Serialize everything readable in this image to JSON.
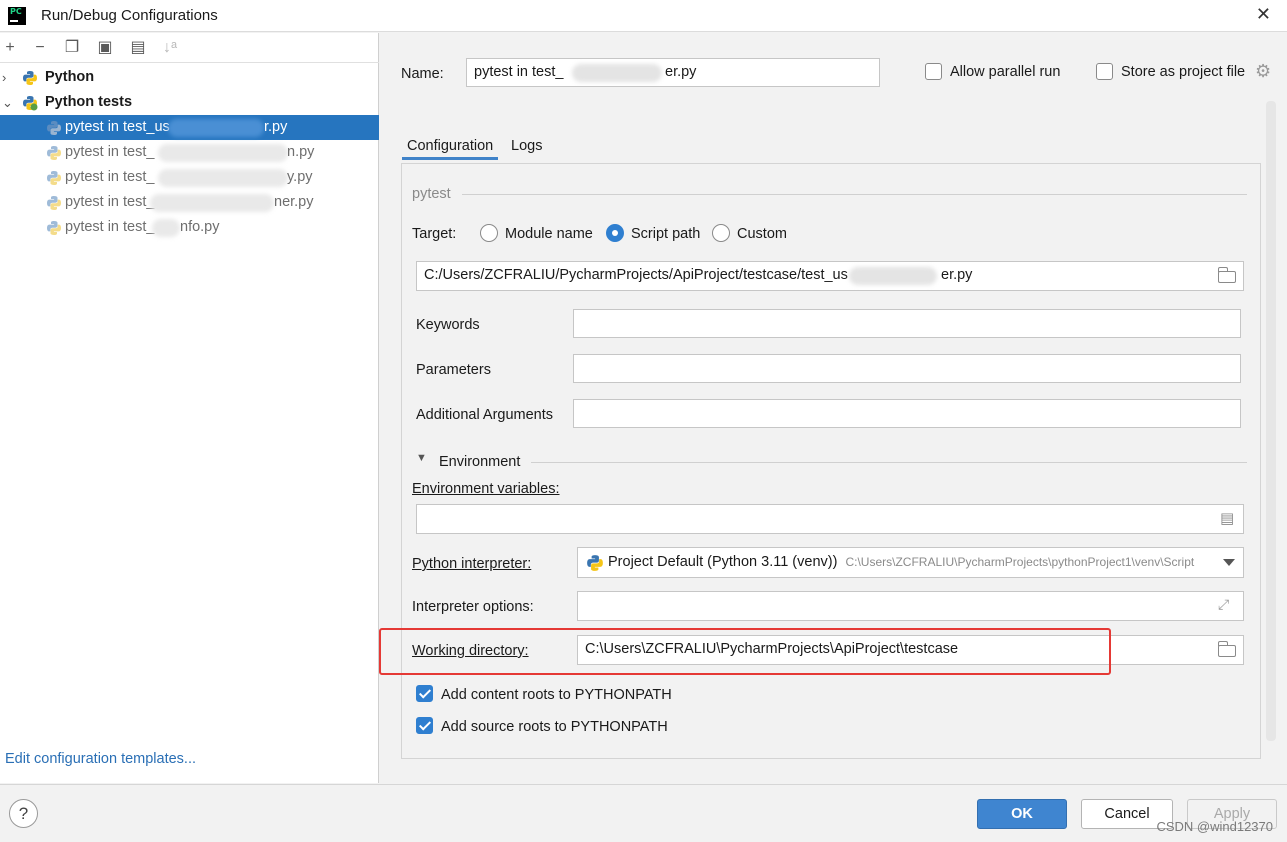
{
  "window": {
    "title": "Run/Debug Configurations",
    "close_glyph": "✕"
  },
  "toolbar": {
    "add": "+",
    "remove": "−",
    "copy": "❐",
    "save": "▣",
    "folder": "▤",
    "sort": "↓ᵃ"
  },
  "tree": {
    "groups": [
      {
        "label": "Python",
        "expanded": false,
        "chevron": "›"
      },
      {
        "label": "Python tests",
        "expanded": true,
        "chevron": "⌄"
      }
    ],
    "items": [
      {
        "prefix": "pytest in test_us",
        "suffix": "r.py",
        "selected": true
      },
      {
        "prefix": "pytest in test_",
        "suffix": "n.py",
        "selected": false
      },
      {
        "prefix": "pytest in test_",
        "suffix": "y.py",
        "selected": false
      },
      {
        "prefix": "pytest in test_",
        "suffix": "ner.py",
        "selected": false
      },
      {
        "prefix": "pytest in test_",
        "suffix": "nfo.py",
        "selected": false
      }
    ],
    "edit_templates": "Edit configuration templates..."
  },
  "header": {
    "name_label": "Name:",
    "name_value_prefix": "pytest in test_",
    "name_value_suffix": "er.py",
    "allow_parallel_label": "Allow parallel run",
    "store_project_label": "Store as project file"
  },
  "tabs": [
    {
      "label": "Configuration",
      "active": true
    },
    {
      "label": "Logs",
      "active": false
    }
  ],
  "config": {
    "section": "pytest",
    "target_label": "Target:",
    "target_options": [
      {
        "label": "Module name",
        "selected": false
      },
      {
        "label": "Script path",
        "selected": true
      },
      {
        "label": "Custom",
        "selected": false
      }
    ],
    "script_path_prefix": "C:/Users/ZCFRALIU/PycharmProjects/ApiProject/testcase/test_us",
    "script_path_suffix": "er.py",
    "keywords_label": "Keywords",
    "parameters_label": "Parameters",
    "additional_args_label": "Additional Arguments",
    "environment_section": "Environment",
    "env_vars_label": "Environment variables:",
    "interpreter_label": "Python interpreter:",
    "interpreter_value": "Project Default (Python 3.11 (venv))",
    "interpreter_path": "C:\\Users\\ZCFRALIU\\PycharmProjects\\pythonProject1\\venv\\Script",
    "interpreter_options_label": "Interpreter options:",
    "working_dir_label": "Working directory:",
    "working_dir_value": "C:\\Users\\ZCFRALIU\\PycharmProjects\\ApiProject\\testcase",
    "add_content_roots_label": "Add content roots to PYTHONPATH",
    "add_content_roots_checked": true,
    "add_source_roots_label": "Add source roots to PYTHONPATH",
    "add_source_roots_checked": true
  },
  "footer": {
    "help": "?",
    "ok": "OK",
    "cancel": "Cancel",
    "apply": "Apply",
    "watermark": "CSDN @wind12370"
  },
  "colors": {
    "selection": "#2675bf",
    "primary_button": "#3f85d0",
    "highlight_box": "#e53935",
    "link": "#2a6fb5"
  }
}
